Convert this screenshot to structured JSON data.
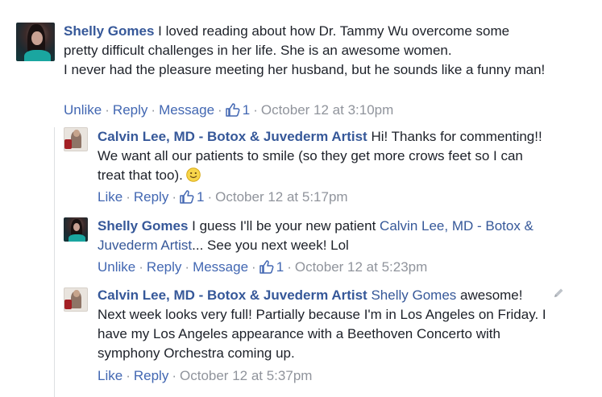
{
  "comments": [
    {
      "author": "Shelly Gomes",
      "text_1": " I loved reading about how Dr. Tammy Wu overcome some pretty difficult challenges in her life. She is an awesome women.",
      "text_2": "I never had the pleasure meeting her husband, but he sounds like a funny man!",
      "actions": [
        "Unlike",
        "Reply",
        "Message"
      ],
      "like_count": "1",
      "timestamp": "October 12 at 3:10pm"
    },
    {
      "author": "Calvin Lee, MD - Botox & Juvederm Artist",
      "text": " Hi! Thanks for commenting!! We want all our patients to smile (so they get more crows feet so I can treat that too).",
      "actions": [
        "Like",
        "Reply"
      ],
      "like_count": "1",
      "timestamp": "October 12 at 5:17pm"
    },
    {
      "author": "Shelly Gomes",
      "text_before": " I guess I'll be your new patient ",
      "mention": "Calvin Lee, MD - Botox & Juvederm Artist",
      "text_after": "... See you next week! Lol",
      "actions": [
        "Unlike",
        "Reply",
        "Message"
      ],
      "like_count": "1",
      "timestamp": "October 12 at 5:23pm"
    },
    {
      "author": "Calvin Lee, MD - Botox & Juvederm Artist",
      "mention": "Shelly Gomes",
      "text": " awesome! Next week looks very full! Partially because I'm in Los Angeles on Friday. I have my Los Angeles appearance with a Beethoven Concerto with symphony Orchestra coming up.",
      "actions": [
        "Like",
        "Reply"
      ],
      "timestamp": "October 12 at 5:37pm"
    }
  ],
  "separator": "·",
  "icons": {
    "like": "thumbs-up-icon",
    "emoji": "smiley-icon",
    "edit": "pencil-icon"
  },
  "colors": {
    "name": "#365899",
    "action": "#4267b2",
    "meta": "#90949c",
    "body": "#1d2129"
  }
}
